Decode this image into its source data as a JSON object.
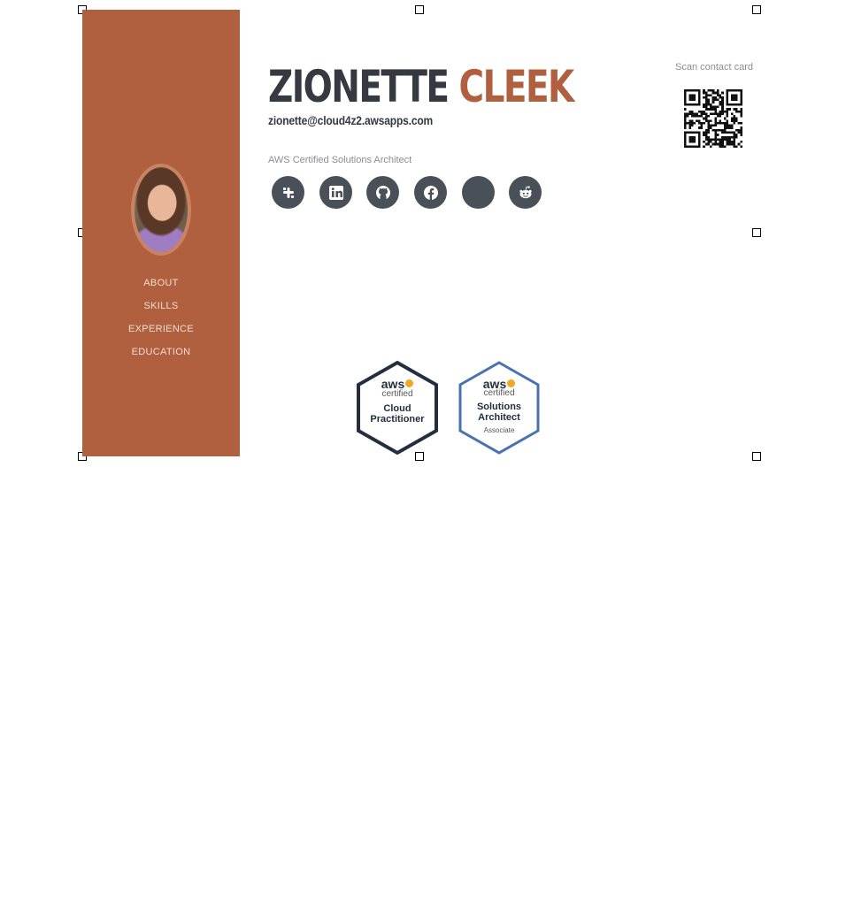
{
  "sidebar": {
    "nav": [
      {
        "label": "ABOUT"
      },
      {
        "label": "SKILLS"
      },
      {
        "label": "EXPERIENCE"
      },
      {
        "label": "EDUCATION"
      }
    ]
  },
  "header": {
    "first_name": "ZIONETTE",
    "last_name": "CLEEK",
    "email": "zionette@cloud4z2.awsapps.com"
  },
  "certification_line": "AWS Certified Solutions Architect",
  "socials": [
    {
      "icon": "slack-icon"
    },
    {
      "icon": "linkedin-icon"
    },
    {
      "icon": "github-icon"
    },
    {
      "icon": "facebook-icon"
    },
    {
      "icon": "blank-icon"
    },
    {
      "icon": "reddit-icon"
    }
  ],
  "qr": {
    "label": "Scan contact card"
  },
  "badges": [
    {
      "brand": "aws",
      "sub": "certified",
      "line1": "Cloud",
      "line2": "Practitioner",
      "line3": "",
      "border_color": "#232f3e"
    },
    {
      "brand": "aws",
      "sub": "certified",
      "line1": "Solutions",
      "line2": "Architect",
      "line3": "Associate",
      "border_color": "#4a72b0"
    }
  ],
  "colors": {
    "accent": "#b0603e",
    "dark": "#343a40",
    "icon_bg": "#495057",
    "aws_orange": "#f5a623"
  }
}
